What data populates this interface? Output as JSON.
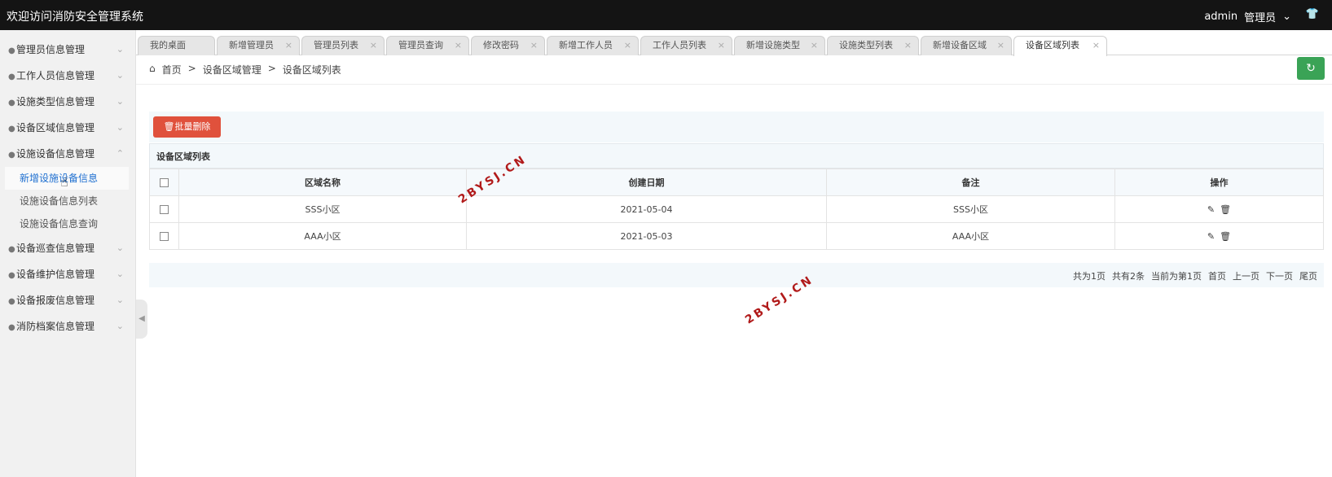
{
  "app": {
    "title": "欢迎访问消防安全管理系统",
    "user": "admin",
    "role": "管理员"
  },
  "sidebar": {
    "items": [
      {
        "label": "管理员信息管理"
      },
      {
        "label": "工作人员信息管理"
      },
      {
        "label": "设施类型信息管理"
      },
      {
        "label": "设备区域信息管理"
      },
      {
        "label": "设施设备信息管理"
      },
      {
        "label": "设备巡查信息管理"
      },
      {
        "label": "设备维护信息管理"
      },
      {
        "label": "设备报废信息管理"
      },
      {
        "label": "消防档案信息管理"
      }
    ],
    "subitems": [
      {
        "label": "新增设施设备信息"
      },
      {
        "label": "设施设备信息列表"
      },
      {
        "label": "设施设备信息查询"
      }
    ]
  },
  "tabs": [
    {
      "label": "我的桌面"
    },
    {
      "label": "新增管理员"
    },
    {
      "label": "管理员列表"
    },
    {
      "label": "管理员查询"
    },
    {
      "label": "修改密码"
    },
    {
      "label": "新增工作人员"
    },
    {
      "label": "工作人员列表"
    },
    {
      "label": "新增设施类型"
    },
    {
      "label": "设施类型列表"
    },
    {
      "label": "新增设备区域"
    },
    {
      "label": "设备区域列表"
    }
  ],
  "breadcrumb": {
    "home": "首页",
    "section": "设备区域管理",
    "page": "设备区域列表"
  },
  "toolbar": {
    "batch_delete": "批量删除"
  },
  "table": {
    "caption": "设备区域列表",
    "headers": [
      "区域名称",
      "创建日期",
      "备注",
      "操作"
    ],
    "rows": [
      {
        "name": "SSS小区",
        "date": "2021-05-04",
        "note": "SSS小区"
      },
      {
        "name": "AAA小区",
        "date": "2021-05-03",
        "note": "AAA小区"
      }
    ]
  },
  "pager": {
    "total_pages": "共为1页",
    "total_items": "共有2条",
    "current": "当前为第1页",
    "first": "首页",
    "prev": "上一页",
    "next": "下一页",
    "last": "尾页"
  },
  "watermark": "2BYSJ.CN",
  "colors": {
    "topbar": "#141414",
    "danger": "#e0513c",
    "success": "#3aa356",
    "link": "#1e6fd0"
  }
}
